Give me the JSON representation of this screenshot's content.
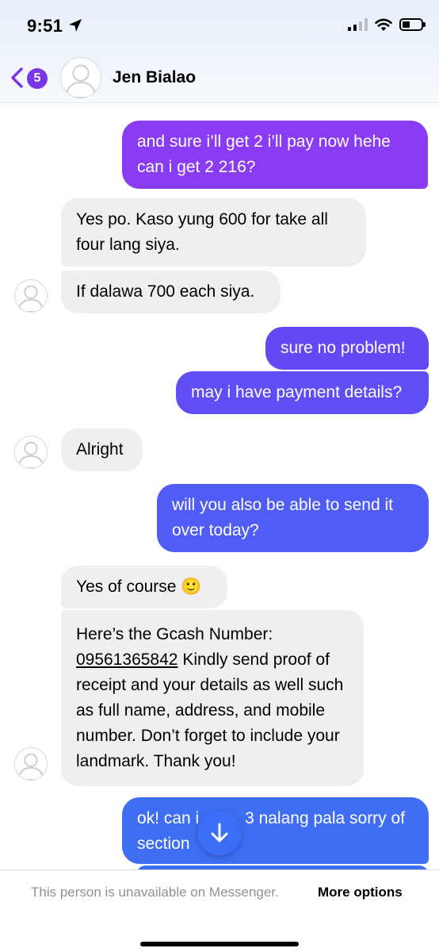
{
  "status_bar": {
    "time": "9:51"
  },
  "header": {
    "back_badge": "5",
    "contact_name": "Jen Bialao"
  },
  "messages": [
    {
      "from": "me",
      "text": "and sure i’ll get 2 i’ll pay now hehe can i get 2 216?"
    },
    {
      "from": "them",
      "text": "Yes po. Kaso yung 600 for take all four lang siya."
    },
    {
      "from": "them",
      "text": "If dalawa 700 each siya."
    },
    {
      "from": "me",
      "text": "sure no problem!"
    },
    {
      "from": "me",
      "text": "may i have payment details?"
    },
    {
      "from": "them",
      "text": "Alright"
    },
    {
      "from": "me",
      "text": "will you also be able to send it over today?"
    },
    {
      "from": "them",
      "text": "Yes of course 🙂"
    },
    {
      "from": "them",
      "text_before": "Here’s the Gcash Number:",
      "number": "09561365842",
      "text_after": " Kindly send proof of receipt and your details as well such as full name, address, and mobile number. Don’t forget to include your landmark. Thank you!"
    },
    {
      "from": "me",
      "text_part1": "ok! can i",
      "text_part2": "3 nalang pala sorry of",
      "text_part3": "section"
    }
  ],
  "footer": {
    "unavailable_text": "This person is unavailable on Messenger.",
    "more_options_label": "More options"
  },
  "colors": {
    "accent_purple": "#7a35e6",
    "bubble_gradient_top": "#8a3cf5",
    "bubble_gradient_bottom": "#3f6ef5",
    "incoming_bubble": "#efeff1"
  },
  "icons": {
    "location": "location-arrow-icon",
    "back": "chevron-left-icon",
    "scroll": "arrow-down-icon"
  }
}
